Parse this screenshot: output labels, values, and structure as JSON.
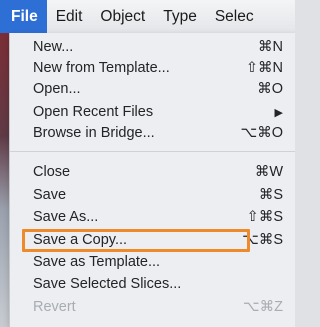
{
  "menubar": {
    "items": [
      {
        "label": "File"
      },
      {
        "label": "Edit"
      },
      {
        "label": "Object"
      },
      {
        "label": "Type"
      },
      {
        "label": "Selec"
      }
    ]
  },
  "file_menu": {
    "items": [
      {
        "label": "New...",
        "shortcut": "⌘N"
      },
      {
        "label": "New from Template...",
        "shortcut": "⇧⌘N"
      },
      {
        "label": "Open...",
        "shortcut": "⌘O"
      },
      {
        "label": "Open Recent Files",
        "shortcut": "▶"
      },
      {
        "label": "Browse in Bridge...",
        "shortcut": "⌥⌘O"
      },
      {
        "label": "Close",
        "shortcut": "⌘W"
      },
      {
        "label": "Save",
        "shortcut": "⌘S"
      },
      {
        "label": "Save As...",
        "shortcut": "⇧⌘S"
      },
      {
        "label": "Save a Copy...",
        "shortcut": "⌥⌘S"
      },
      {
        "label": "Save as Template...",
        "shortcut": ""
      },
      {
        "label": "Save Selected Slices...",
        "shortcut": ""
      },
      {
        "label": "Revert",
        "shortcut": "⌥⌘Z"
      }
    ]
  },
  "colors": {
    "active_menu": "#2e6fd6",
    "highlight_outline": "#ef8a2a",
    "disabled_text": "#a9acb1"
  }
}
